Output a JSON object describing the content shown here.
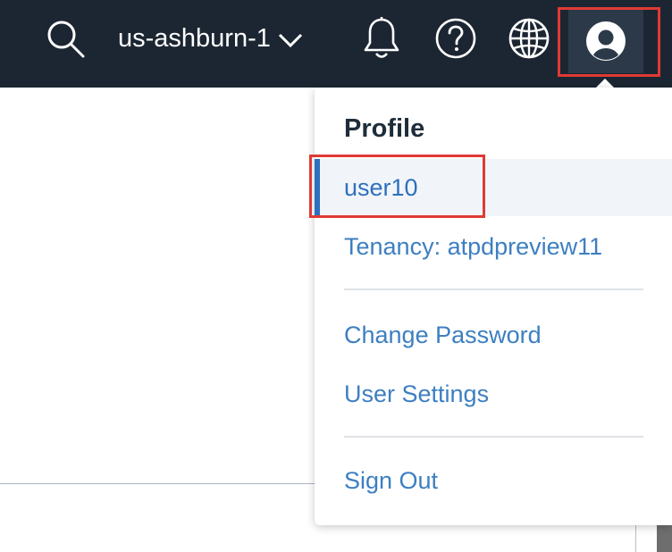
{
  "topbar": {
    "region": "us-ashburn-1",
    "icons": {
      "search": "search-icon",
      "region_toggle": "chevron-down-icon",
      "notifications": "bell-icon",
      "help": "help-icon",
      "language": "globe-icon",
      "profile": "user-avatar-icon"
    }
  },
  "profile_menu": {
    "title": "Profile",
    "items": [
      {
        "label": "user10",
        "active": true
      },
      {
        "label": "Tenancy: atpdpreview11"
      },
      {
        "label": "Change Password"
      },
      {
        "label": "User Settings"
      },
      {
        "label": "Sign Out"
      }
    ]
  },
  "colors": {
    "topbar_bg": "#1c2632",
    "link": "#3d7fc1",
    "active_accent": "#2f6fbd",
    "highlight": "#e03a34"
  }
}
